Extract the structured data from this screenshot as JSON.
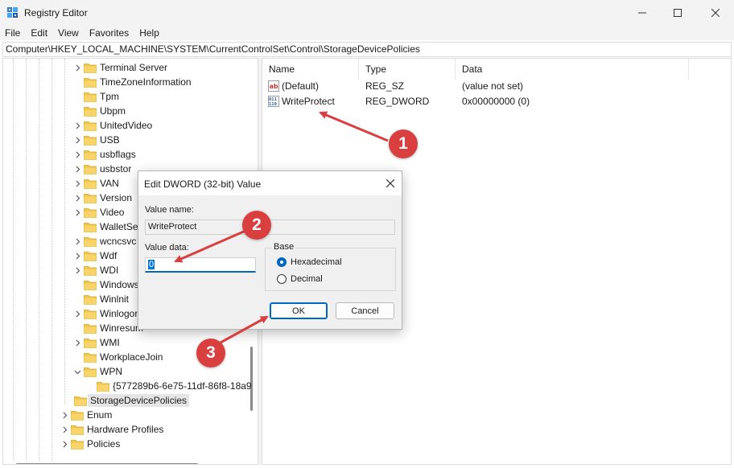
{
  "window": {
    "title": "Registry Editor",
    "icon": "registry-icon",
    "controls": [
      "minimize-icon",
      "maximize-icon",
      "close-icon"
    ]
  },
  "menu": [
    "File",
    "Edit",
    "View",
    "Favorites",
    "Help"
  ],
  "address": "Computer\\HKEY_LOCAL_MACHINE\\SYSTEM\\CurrentControlSet\\Control\\StorageDevicePolicies",
  "tree": {
    "items": [
      {
        "label": "Terminal Server",
        "expandable": true
      },
      {
        "label": "TimeZoneInformation",
        "expandable": false
      },
      {
        "label": "Tpm",
        "expandable": false
      },
      {
        "label": "Ubpm",
        "expandable": false
      },
      {
        "label": "UnitedVideo",
        "expandable": true
      },
      {
        "label": "USB",
        "expandable": true
      },
      {
        "label": "usbflags",
        "expandable": true
      },
      {
        "label": "usbstor",
        "expandable": true
      },
      {
        "label": "VAN",
        "expandable": true
      },
      {
        "label": "Version",
        "expandable": true
      },
      {
        "label": "Video",
        "expandable": true
      },
      {
        "label": "WalletSer",
        "expandable": false
      },
      {
        "label": "wcncsvc",
        "expandable": true
      },
      {
        "label": "Wdf",
        "expandable": true
      },
      {
        "label": "WDI",
        "expandable": true
      },
      {
        "label": "Windows",
        "expandable": false
      },
      {
        "label": "Winlnit",
        "expandable": false
      },
      {
        "label": "Winlogon",
        "expandable": true
      },
      {
        "label": "Winresum",
        "expandable": false
      },
      {
        "label": "WMI",
        "expandable": true
      },
      {
        "label": "WorkplaceJoin",
        "expandable": false
      },
      {
        "label": "WPN",
        "expandable": true,
        "expanded": true
      },
      {
        "label": "{577289b6-6e75-11df-86f8-18a9",
        "expandable": false
      },
      {
        "label": "StorageDevicePolicies",
        "expandable": false,
        "selected": true
      },
      {
        "label": "Enum",
        "expandable": true
      },
      {
        "label": "Hardware Profiles",
        "expandable": true
      },
      {
        "label": "Policies",
        "expandable": true
      }
    ]
  },
  "values_table": {
    "columns": [
      "Name",
      "Type",
      "Data"
    ],
    "rows": [
      {
        "icon": "string-value-icon",
        "name": "(Default)",
        "type": "REG_SZ",
        "data": "(value not set)"
      },
      {
        "icon": "binary-value-icon",
        "name": "WriteProtect",
        "type": "REG_DWORD",
        "data": "0x00000000 (0)"
      }
    ]
  },
  "dialog": {
    "title": "Edit DWORD (32-bit) Value",
    "value_name_label": "Value name:",
    "value_name": "WriteProtect",
    "value_data_label": "Value data:",
    "value_data": "0",
    "base_label": "Base",
    "base_options": [
      {
        "label": "Hexadecimal",
        "selected": true
      },
      {
        "label": "Decimal",
        "selected": false
      }
    ],
    "ok_label": "OK",
    "cancel_label": "Cancel"
  },
  "annotations": {
    "color": "#d93f3f",
    "badges": [
      "1",
      "2",
      "3"
    ]
  },
  "colors": {
    "accent": "#0067c0",
    "folder": "#f3c54a",
    "selection": "#e5e5e5"
  }
}
